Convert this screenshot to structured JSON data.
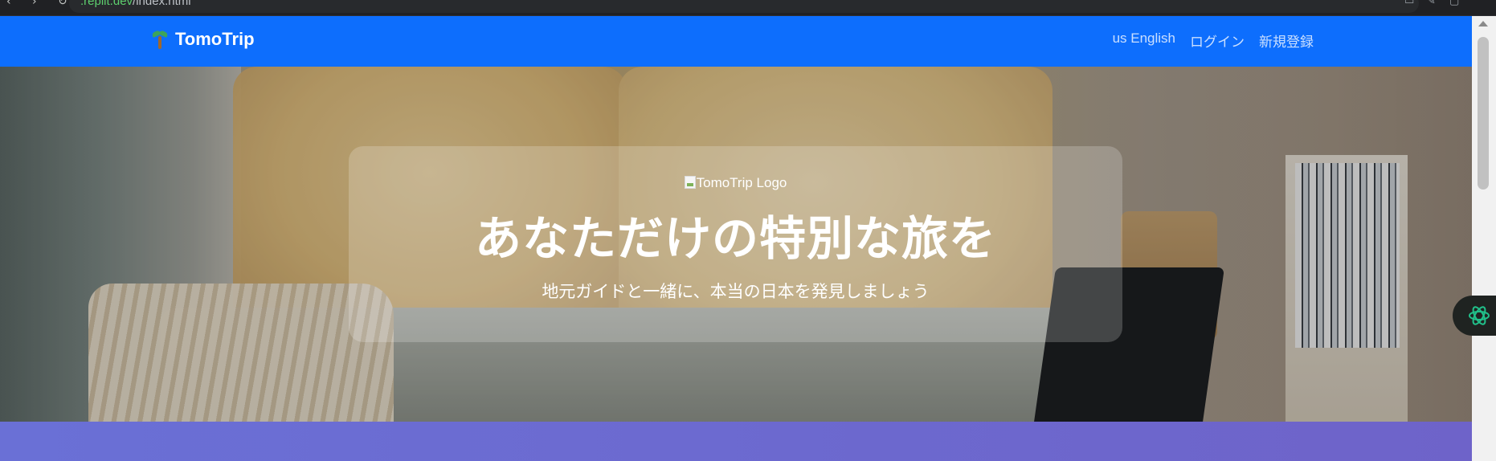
{
  "browser": {
    "url_domain": ".replit.dev",
    "url_path": "/index.html"
  },
  "navbar": {
    "brand": "TomoTrip",
    "links": {
      "language": "us English",
      "login": "ログイン",
      "signup": "新規登録"
    }
  },
  "hero": {
    "logo_alt": "TomoTrip Logo",
    "title": "あなただけの特別な旅を",
    "subtitle": "地元ガイドと一緒に、本当の日本を発見しましょう"
  },
  "colors": {
    "navbar": "#0d6efd",
    "purple_section_start": "#6a70d6",
    "purple_section_end": "#6e63c9"
  }
}
